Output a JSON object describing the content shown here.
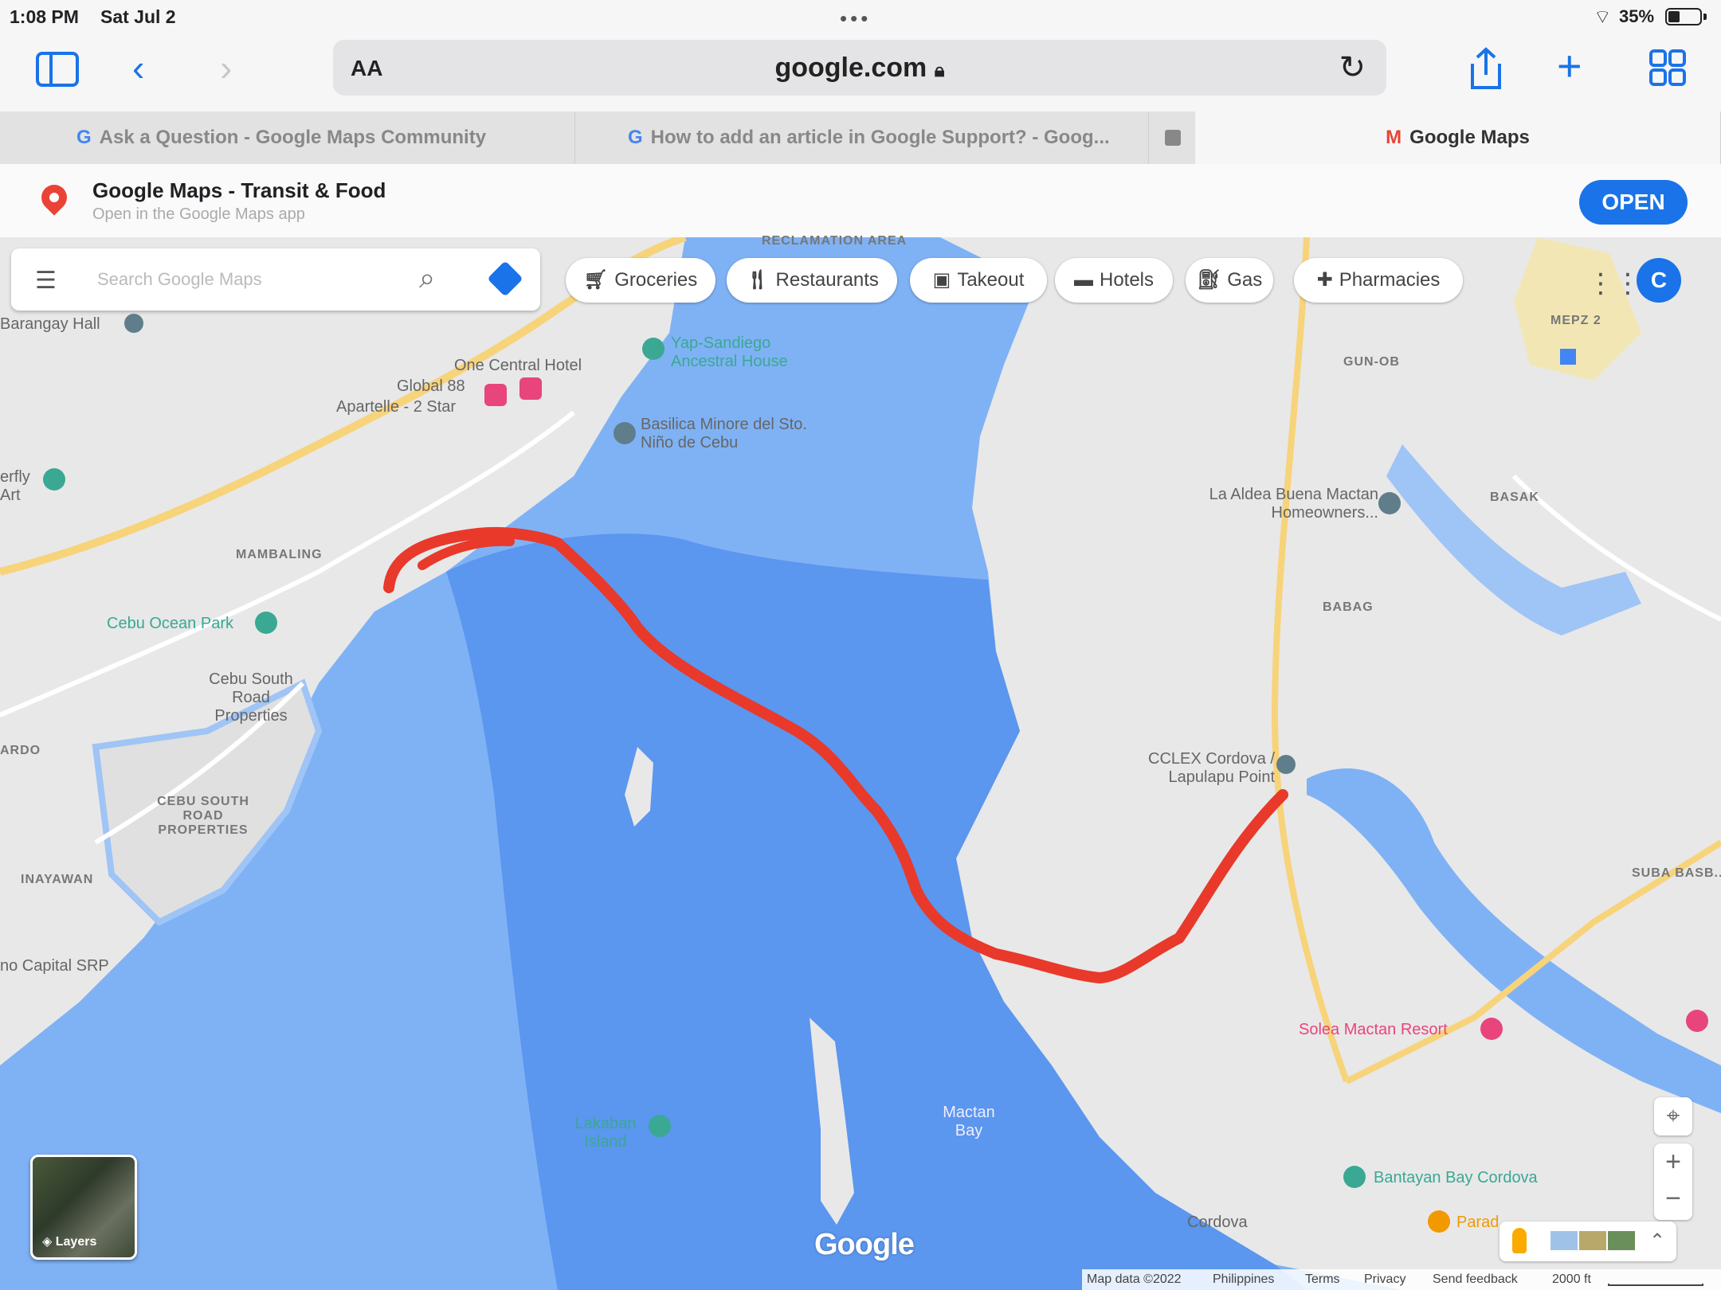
{
  "status": {
    "time": "1:08 PM",
    "date": "Sat Jul 2",
    "battery": "35%"
  },
  "toolbar": {
    "aa": "AA",
    "url": "google.com"
  },
  "tabs": [
    {
      "label": "Ask a Question - Google Maps Community"
    },
    {
      "label": "How to add an article in Google Support? - Goog..."
    },
    {
      "label": "Google Maps"
    }
  ],
  "banner": {
    "title": "Google Maps - Transit & Food",
    "subtitle": "Open in the Google Maps app",
    "open": "OPEN"
  },
  "search": {
    "placeholder": "Search Google Maps"
  },
  "chips": [
    "Groceries",
    "Restaurants",
    "Takeout",
    "Hotels",
    "Gas",
    "Pharmacies"
  ],
  "account_initial": "C",
  "map_labels": {
    "reclamation": "RECLAMATION AREA",
    "barangay_hall": "Barangay Hall",
    "one_central": "One Central Hotel",
    "global88": "Global 88",
    "apartelle": "Apartelle - 2 Star",
    "yap": "Yap-Sandiego Ancestral House",
    "basilica": "Basilica Minore del Sto. Niño de Cebu",
    "butterfly": "erfly Art",
    "mambaling": "MAMBALING",
    "cebu_ocean": "Cebu Ocean Park",
    "csr1": "Cebu South Road Properties",
    "csr2": "CEBU SOUTH ROAD PROPERTIES",
    "ardo": "ARDO",
    "inayawan": "INAYAWAN",
    "capital": "no Capital SRP",
    "gun_ob": "GUN-OB",
    "mepz": "MEPZ 2",
    "la_aldea": "La Aldea Buena Mactan Homeowners...",
    "basak": "BASAK",
    "babag": "BABAG",
    "cclex": "CCLEX Cordova / Lapulapu Point",
    "suba": "SUBA BASB...",
    "solea": "Solea Mactan Resort",
    "lakaban": "Lakaban Island",
    "mactan_bay": "Mactan Bay",
    "bantayan": "Bantayan Bay Cordova",
    "cordova": "Cordova",
    "paradise": "Parad..."
  },
  "layers": "Layers",
  "footer": [
    "Map data ©2022",
    "Philippines",
    "Terms",
    "Privacy",
    "Send feedback",
    "2000 ft"
  ],
  "colors": {
    "water": "#7fb2f5",
    "deep_water": "#5b96ef",
    "land": "#e8e8e8",
    "route": "#e8392b",
    "accent": "#1a73e8"
  }
}
